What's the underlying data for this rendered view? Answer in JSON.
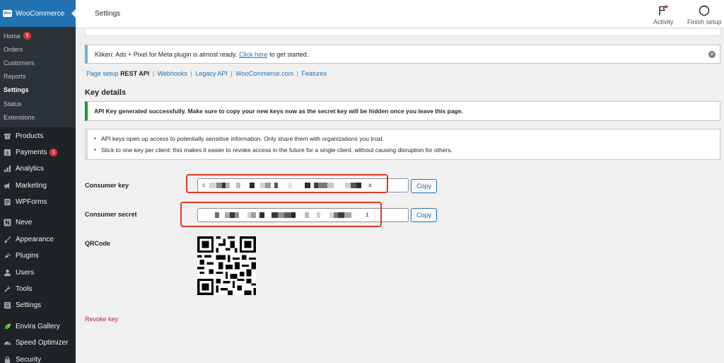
{
  "sidebar": {
    "brand": {
      "label": "WooCommerce",
      "logo": "Woo"
    },
    "submenu": [
      {
        "label": "Home",
        "badge": "5",
        "active": false
      },
      {
        "label": "Orders",
        "active": false
      },
      {
        "label": "Customers",
        "active": false
      },
      {
        "label": "Reports",
        "active": false
      },
      {
        "label": "Settings",
        "active": true
      },
      {
        "label": "Status",
        "active": false
      },
      {
        "label": "Extensions",
        "active": false
      }
    ],
    "menu": [
      {
        "label": "Products",
        "icon": "archive-icon"
      },
      {
        "label": "Payments",
        "icon": "payments-icon",
        "badge": "1"
      },
      {
        "label": "Analytics",
        "icon": "bar-chart-icon"
      },
      {
        "label": "Marketing",
        "icon": "megaphone-icon"
      },
      {
        "label": "WPForms",
        "icon": "forms-icon"
      },
      {
        "label": "Neve",
        "icon": "neve-icon"
      },
      {
        "label": "Appearance",
        "icon": "paintbrush-icon"
      },
      {
        "label": "Plugins",
        "icon": "plugin-icon"
      },
      {
        "label": "Users",
        "icon": "users-icon"
      },
      {
        "label": "Tools",
        "icon": "wrench-icon"
      },
      {
        "label": "Settings",
        "icon": "settings-icon"
      },
      {
        "label": "Envira Gallery",
        "icon": "leaf-icon"
      },
      {
        "label": "Speed Optimizer",
        "icon": "speedometer-icon"
      },
      {
        "label": "Security",
        "icon": "lock-icon"
      }
    ]
  },
  "topbar": {
    "title": "Settings",
    "activity_label": "Activity",
    "finish_label": "Finish setup"
  },
  "notice": {
    "text_before": "Kliken: Ads + Pixel for Meta plugin is almost ready.",
    "link": "Click here",
    "text_after": "to get started."
  },
  "subnav": {
    "items": [
      "Page setup",
      "REST API",
      "Webhooks",
      "Legacy API",
      "WooCommerce.com",
      "Features"
    ],
    "current": "REST API"
  },
  "key_details": {
    "heading": "Key details",
    "success": "API Key generated successfully. Make sure to copy your new keys now as the secret key will be hidden once you leave this page.",
    "tips": [
      "API keys open up access to potentially sensitive information. Only share them with organizations you trust.",
      "Stick to one key per client: this makes it easier to revoke access in the future for a single client, without causing disruption for others."
    ],
    "consumer_key_label": "Consumer key",
    "consumer_key_start": "c",
    "consumer_key_end": "a",
    "consumer_secret_label": "Consumer secret",
    "consumer_secret_end": "1",
    "copy_label": "Copy",
    "qrcode_label": "QRCode",
    "revoke_label": "Revoke key"
  },
  "colors": {
    "sidebar_bg": "#1d2327",
    "accent": "#2271b1",
    "highlight": "#e0392b",
    "success": "#00a32a",
    "danger": "#b32d2e"
  }
}
